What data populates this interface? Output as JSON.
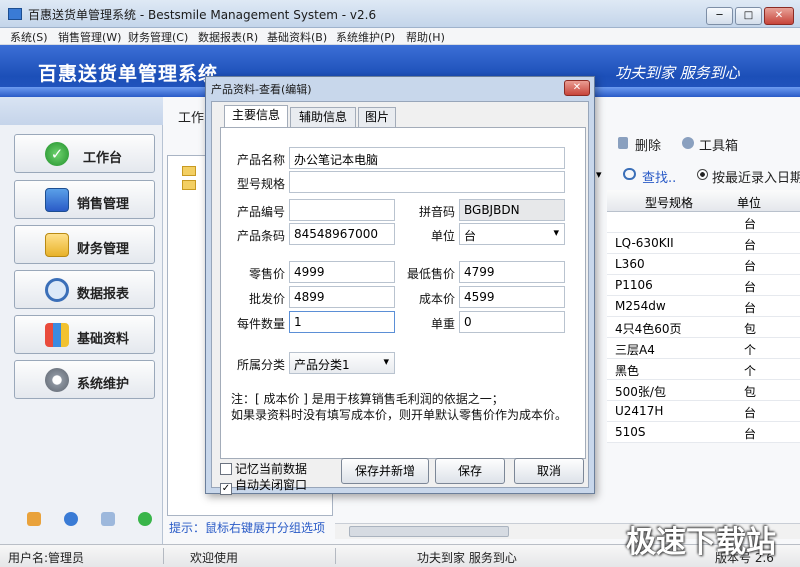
{
  "window": {
    "title": "百惠送货单管理系统 - Bestsmile Management System - v2.6",
    "min": "─",
    "max": "□",
    "close": "✕"
  },
  "menu": [
    "系统(S)",
    "销售管理(W)",
    "财务管理(C)",
    "数据报表(R)",
    "基础资料(B)",
    "系统维护(P)",
    "帮助(H)"
  ],
  "banner": {
    "logo": "百惠送货单管理系统",
    "slogan": "功夫到家  服务到心"
  },
  "sidebar": {
    "items": [
      {
        "label": "工作台",
        "icon": "check-icon"
      },
      {
        "label": "销售管理",
        "icon": "window-icon"
      },
      {
        "label": "财务管理",
        "icon": "folder-icon"
      },
      {
        "label": "数据报表",
        "icon": "magnifier-icon"
      },
      {
        "label": "基础资料",
        "icon": "building-icon"
      },
      {
        "label": "系统维护",
        "icon": "gear-icon"
      }
    ]
  },
  "main": {
    "tab": "工作",
    "hint": "提示：鼠标右键展开分组选项",
    "toolbar": {
      "delete": "删除",
      "toolbox": "工具箱",
      "search": "查找..",
      "sort_radio": "按最近录入日期"
    },
    "grid": {
      "headers": [
        "型号规格",
        "单位"
      ],
      "rows": [
        {
          "model": "",
          "unit": "台"
        },
        {
          "model": "LQ-630KII",
          "unit": "台"
        },
        {
          "model": "L360",
          "unit": "台"
        },
        {
          "model": "P1106",
          "unit": "台"
        },
        {
          "model": "M254dw",
          "unit": "台"
        },
        {
          "model": "4只4色60页",
          "unit": "包"
        },
        {
          "model": "三层A4",
          "unit": "个"
        },
        {
          "model": "黑色",
          "unit": "个"
        },
        {
          "model": "500张/包",
          "unit": "包"
        },
        {
          "model": "U2417H",
          "unit": "台"
        },
        {
          "model": "510S",
          "unit": "台"
        }
      ]
    }
  },
  "dialog": {
    "title": "产品资料-查看(编辑)",
    "tabs": [
      "主要信息",
      "辅助信息",
      "图片"
    ],
    "fields": {
      "name_label": "产品名称",
      "name": "办公笔记本电脑",
      "model_label": "型号规格",
      "model": "",
      "code_label": "产品编号",
      "code": "",
      "pinyin_label": "拼音码",
      "pinyin": "BGBJBDN",
      "barcode_label": "产品条码",
      "barcode": "84548967000",
      "unit_label": "单位",
      "unit": "台",
      "retail_label": "零售价",
      "retail": "4999",
      "min_label": "最低售价",
      "min": "4799",
      "wholesale_label": "批发价",
      "wholesale": "4899",
      "cost_label": "成本价",
      "cost": "4599",
      "qty_label": "每件数量",
      "qty": "1",
      "weight_label": "单重",
      "weight": "0",
      "category_label": "所属分类",
      "category": "产品分类1"
    },
    "note1": "注：[ 成本价 ] 是用于核算销售毛利润的依据之一；",
    "note2": "如果录资料时没有填写成本价，则开单默认零售价作为成本价。",
    "remember": "记忆当前数据",
    "autoclose": "自动关闭窗口",
    "buttons": {
      "save_new": "保存并新增",
      "save": "保存",
      "cancel": "取消"
    }
  },
  "status": {
    "user": "用户名:管理员",
    "welcome": "欢迎使用",
    "motto": "功夫到家 服务到心",
    "version": "版本号 2.6"
  },
  "watermark": "极速下载站"
}
